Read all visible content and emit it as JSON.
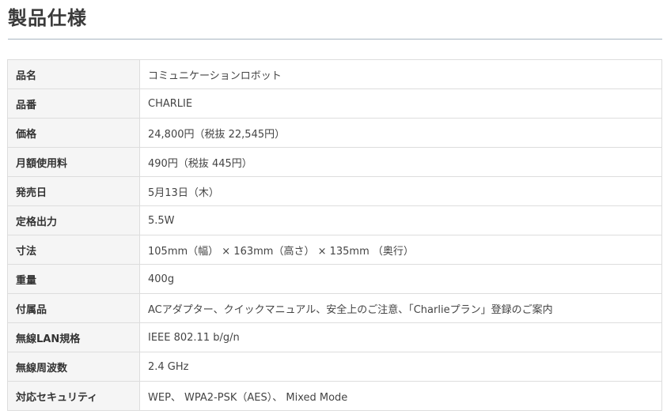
{
  "page": {
    "title": "製品仕様"
  },
  "specs": [
    {
      "label": "品名",
      "value": "コミュニケーションロボット"
    },
    {
      "label": "品番",
      "value": "CHARLIE"
    },
    {
      "label": "価格",
      "value": "24,800円（税抜 22,545円）"
    },
    {
      "label": "月額使用料",
      "value": "490円（税抜 445円）"
    },
    {
      "label": "発売日",
      "value": "5月13日（木）"
    },
    {
      "label": "定格出力",
      "value": "5.5W"
    },
    {
      "label": "寸法",
      "value": "105mm（幅） × 163mm（高さ） × 135mm （奥行）"
    },
    {
      "label": "重量",
      "value": "400g"
    },
    {
      "label": "付属品",
      "value": "ACアダプター、クイックマニュアル、安全上のご注意、「Charlieプラン」登録のご案内"
    },
    {
      "label": "無線LAN規格",
      "value": "IEEE 802.11 b/g/n"
    },
    {
      "label": "無線周波数",
      "value": "2.4 GHz"
    },
    {
      "label": "対応セキュリティ",
      "value": "WEP、 WPA2-PSK（AES）、 Mixed Mode"
    }
  ]
}
